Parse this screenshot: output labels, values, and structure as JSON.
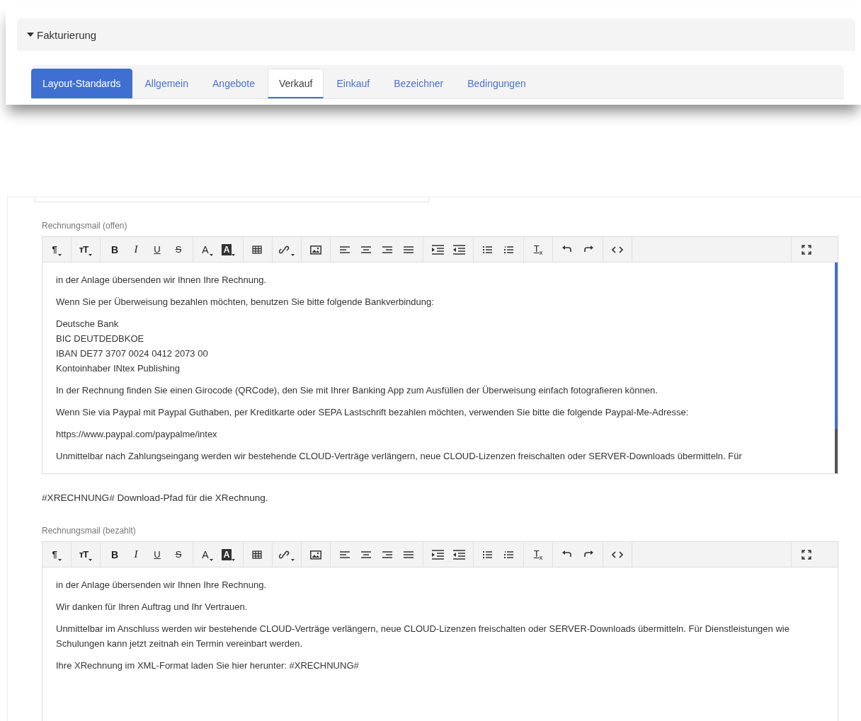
{
  "section": {
    "title": "Fakturierung",
    "expanded": true
  },
  "tabs": [
    {
      "label": "Layout-Standards",
      "kind": "button",
      "selected": false
    },
    {
      "label": "Allgemein",
      "kind": "tab",
      "selected": false
    },
    {
      "label": "Angebote",
      "kind": "tab",
      "selected": false
    },
    {
      "label": "Verkauf",
      "kind": "tab",
      "selected": true
    },
    {
      "label": "Einkauf",
      "kind": "tab",
      "selected": false
    },
    {
      "label": "Bezeichner",
      "kind": "tab",
      "selected": false
    },
    {
      "label": "Bedingungen",
      "kind": "tab",
      "selected": false
    }
  ],
  "editors": [
    {
      "label": "Rechnungsmail (offen)",
      "scrollable": true,
      "toolbar": [
        [
          {
            "kind": "para",
            "text": "¶",
            "dropdown": true
          }
        ],
        [
          {
            "kind": "size",
            "text": "тT",
            "dropdown": true
          }
        ],
        [
          {
            "kind": "bold",
            "text": "B"
          },
          {
            "kind": "italic",
            "text": "I"
          },
          {
            "kind": "underline",
            "text": "U"
          },
          {
            "kind": "strike",
            "text": "S"
          }
        ],
        [
          {
            "kind": "color",
            "text": "A",
            "dropdown": true
          },
          {
            "kind": "highlight",
            "text": "A",
            "dropdown": true
          }
        ],
        [
          {
            "kind": "table"
          }
        ],
        [
          {
            "kind": "link",
            "dropdown": true
          }
        ],
        [
          {
            "kind": "image"
          }
        ],
        [
          {
            "kind": "align-left"
          },
          {
            "kind": "align-center"
          },
          {
            "kind": "align-right"
          },
          {
            "kind": "justify"
          }
        ],
        [
          {
            "kind": "indent"
          },
          {
            "kind": "outdent"
          }
        ],
        [
          {
            "kind": "bullet-list"
          },
          {
            "kind": "numbered-list"
          }
        ],
        [
          {
            "kind": "clear",
            "text": "T",
            "sub": "x"
          }
        ],
        [
          {
            "kind": "undo"
          },
          {
            "kind": "redo"
          }
        ],
        [
          {
            "kind": "code"
          }
        ]
      ],
      "paragraphs": [
        [
          "in der Anlage übersenden wir Ihnen Ihre Rechnung."
        ],
        [
          "Wenn Sie per Überweisung bezahlen möchten, benutzen Sie bitte folgende Bankverbindung:"
        ],
        [
          "Deutsche Bank",
          "BIC DEUTDEDBKOE",
          "IBAN DE77 3707 0024 0412 2073 00",
          "Kontoinhaber INtex Publishing"
        ],
        [
          "In der Rechnung finden Sie einen Girocode (QRCode), den Sie mit Ihrer Banking App zum Ausfüllen der Überweisung einfach fotografieren können."
        ],
        [
          "Wenn Sie via Paypal mit Paypal Guthaben, per Kreditkarte oder SEPA Lastschrift bezahlen möchten, verwenden Sie bitte die folgende Paypal-Me-Adresse:"
        ],
        [
          "https://www.paypal.com/paypalme/intex"
        ],
        [
          "Unmittelbar nach Zahlungseingang werden wir bestehende CLOUD-Verträge verlängern, neue CLOUD-Lizenzen freischalten oder SERVER-Downloads übermitteln. Für"
        ]
      ],
      "hint": "#XRECHNUNG# Download-Pfad für die XRechnung."
    },
    {
      "label": "Rechnungsmail (bezahlt)",
      "scrollable": false,
      "toolbar": [
        [
          {
            "kind": "para",
            "text": "¶",
            "dropdown": true
          }
        ],
        [
          {
            "kind": "size",
            "text": "тT",
            "dropdown": true
          }
        ],
        [
          {
            "kind": "bold",
            "text": "B"
          },
          {
            "kind": "italic",
            "text": "I"
          },
          {
            "kind": "underline",
            "text": "U"
          },
          {
            "kind": "strike",
            "text": "S"
          }
        ],
        [
          {
            "kind": "color",
            "text": "A",
            "dropdown": true
          },
          {
            "kind": "highlight",
            "text": "A",
            "dropdown": true
          }
        ],
        [
          {
            "kind": "table"
          }
        ],
        [
          {
            "kind": "link",
            "dropdown": true
          }
        ],
        [
          {
            "kind": "image"
          }
        ],
        [
          {
            "kind": "align-left"
          },
          {
            "kind": "align-center"
          },
          {
            "kind": "align-right"
          },
          {
            "kind": "justify"
          }
        ],
        [
          {
            "kind": "indent"
          },
          {
            "kind": "outdent"
          }
        ],
        [
          {
            "kind": "bullet-list"
          },
          {
            "kind": "numbered-list"
          }
        ],
        [
          {
            "kind": "clear",
            "text": "T",
            "sub": "x"
          }
        ],
        [
          {
            "kind": "undo"
          },
          {
            "kind": "redo"
          }
        ],
        [
          {
            "kind": "code"
          }
        ]
      ],
      "paragraphs": [
        [
          "in der Anlage übersenden wir Ihnen Ihre Rechnung."
        ],
        [
          "Wir danken für Ihren Auftrag und Ihr Vertrauen."
        ],
        [
          "Unmittelbar im Anschluss werden wir bestehende CLOUD-Verträge verlängern, neue CLOUD-Lizenzen freischalten oder SERVER-Downloads übermitteln. Für Dienstleistungen wie",
          "Schulungen kann jetzt zeitnah ein Termin vereinbart werden."
        ],
        [
          "Ihre XRechnung im XML-Format laden Sie hier herunter: #XRECHNUNG#"
        ]
      ]
    }
  ]
}
